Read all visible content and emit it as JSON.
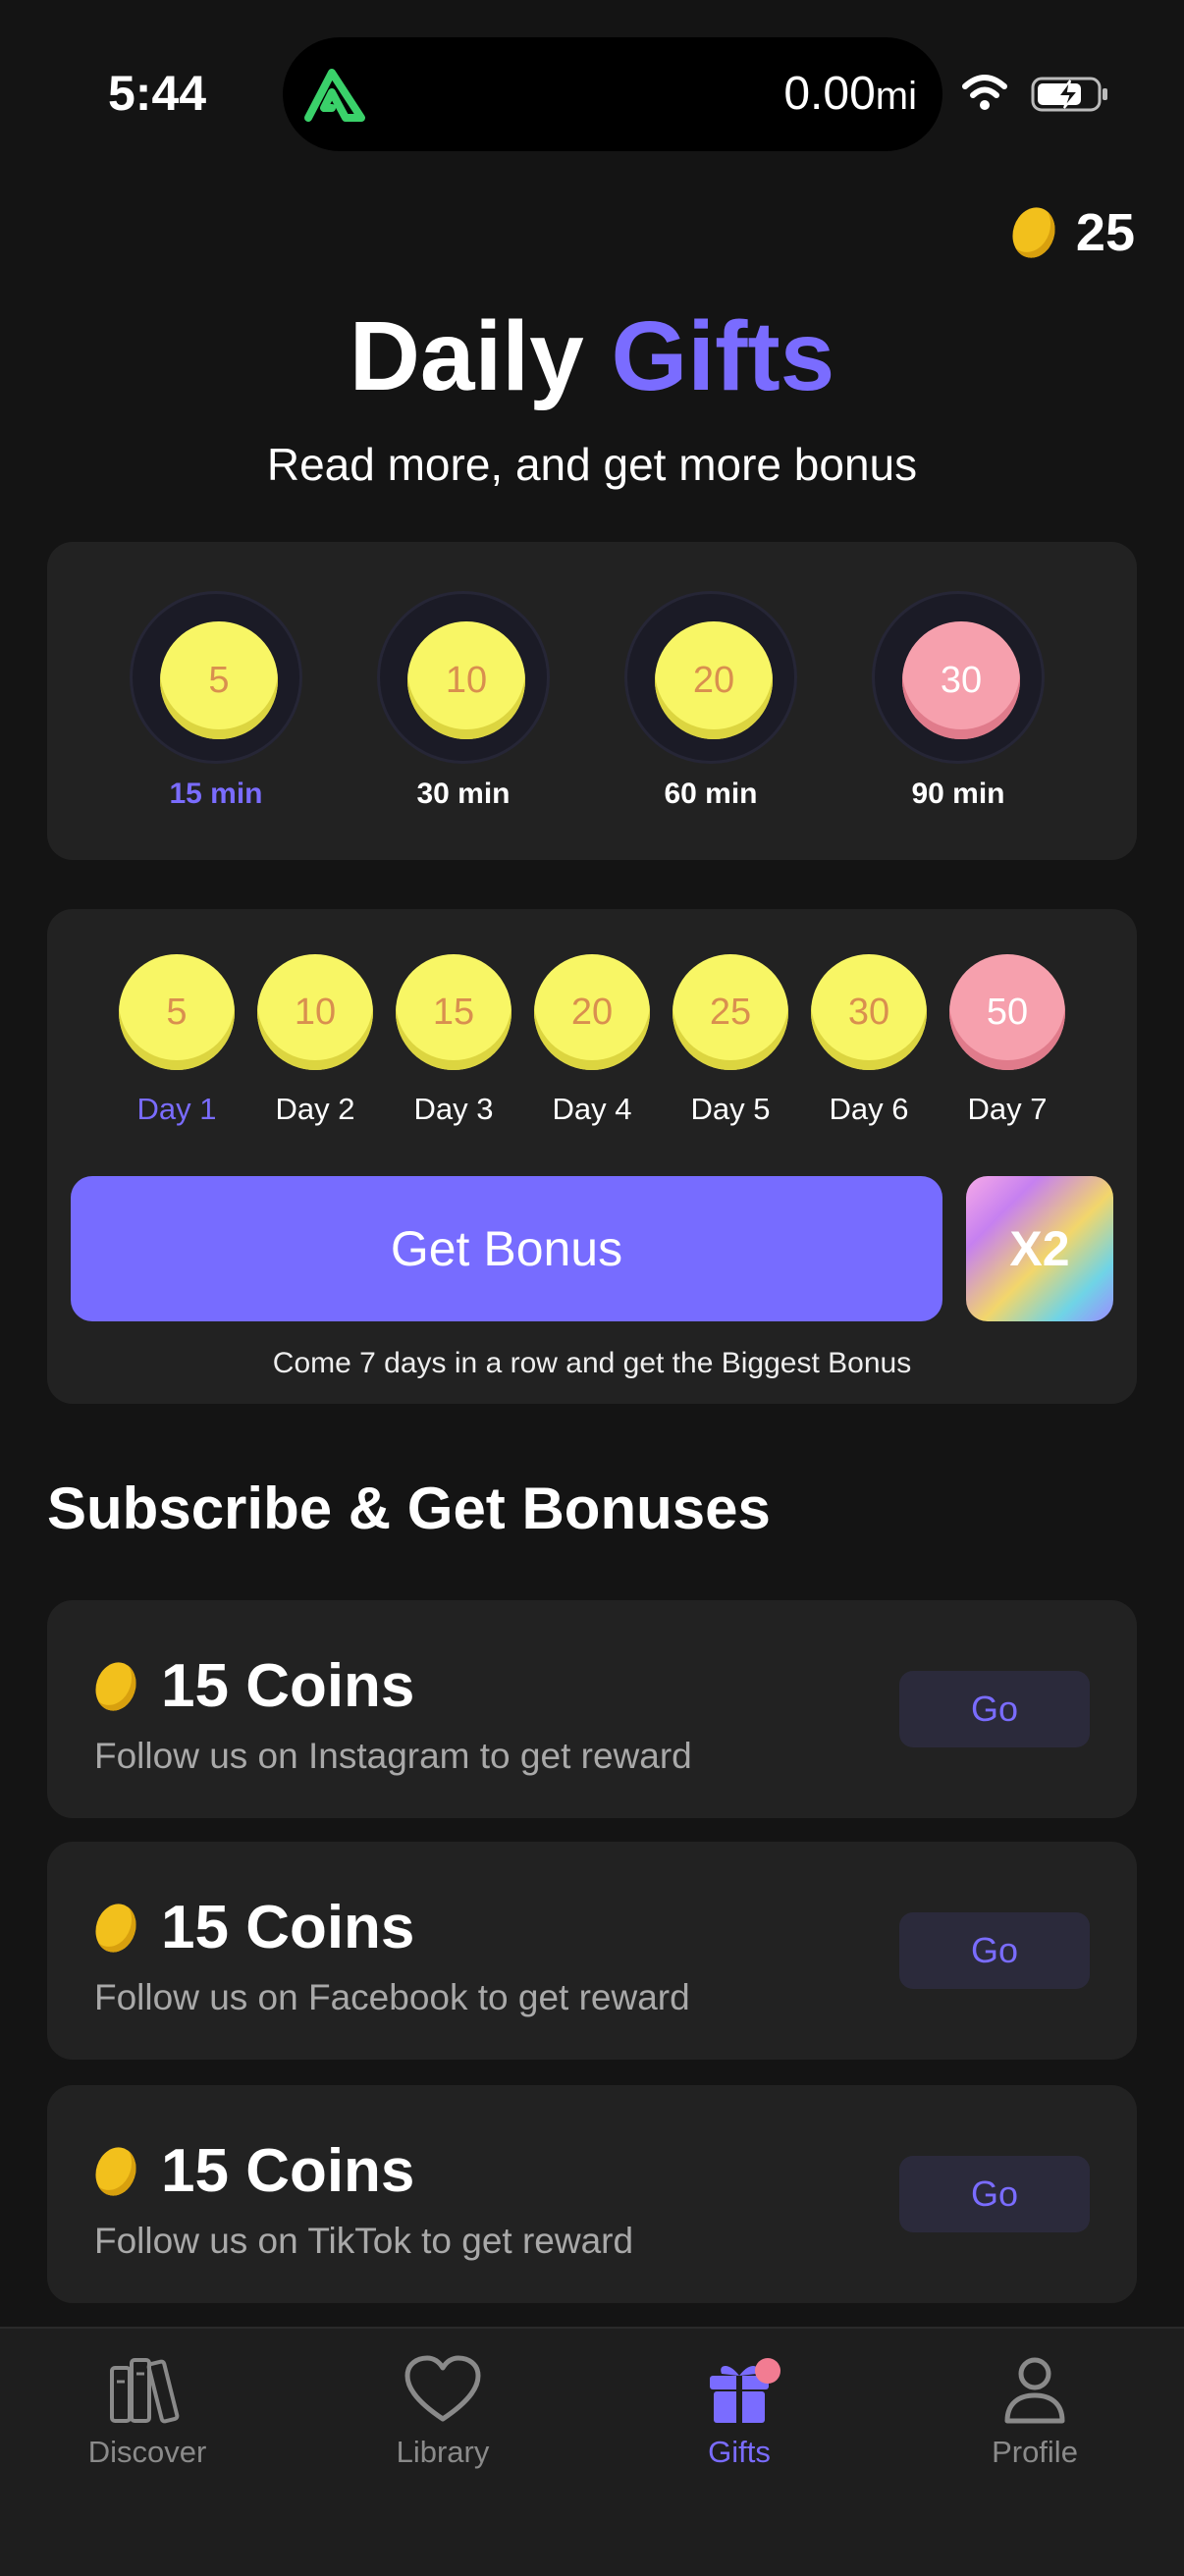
{
  "status": {
    "time": "5:44",
    "distance_value": "0.00",
    "distance_unit": "mi"
  },
  "balance": "25",
  "title": {
    "part1": "Daily",
    "part2": "Gifts"
  },
  "subtitle": "Read more, and get more bonus",
  "timers": [
    {
      "value": "5",
      "label": "15 min",
      "active": true
    },
    {
      "value": "10",
      "label": "30 min"
    },
    {
      "value": "20",
      "label": "60 min"
    },
    {
      "value": "30",
      "label": "90 min",
      "special": true
    }
  ],
  "days": [
    {
      "value": "5",
      "label": "Day 1",
      "active": true
    },
    {
      "value": "10",
      "label": "Day 2"
    },
    {
      "value": "15",
      "label": "Day 3"
    },
    {
      "value": "20",
      "label": "Day 4"
    },
    {
      "value": "25",
      "label": "Day 5"
    },
    {
      "value": "30",
      "label": "Day 6"
    },
    {
      "value": "50",
      "label": "Day 7",
      "special": true
    }
  ],
  "bonus_button": "Get Bonus",
  "multiplier": "X2",
  "streak_note": "Come 7 days in a row and get the Biggest Bonus",
  "section_title": "Subscribe & Get Bonuses",
  "subscriptions": [
    {
      "coins": "15 Coins",
      "desc": "Follow us on Instagram to get reward",
      "action": "Go"
    },
    {
      "coins": "15 Coins",
      "desc": "Follow us on Facebook to get reward",
      "action": "Go"
    },
    {
      "coins": "15 Coins",
      "desc": "Follow us on TikTok to get reward",
      "action": "Go"
    }
  ],
  "tabs": [
    {
      "label": "Discover",
      "icon": "books-icon"
    },
    {
      "label": "Library",
      "icon": "heart-icon"
    },
    {
      "label": "Gifts",
      "icon": "gift-icon",
      "active": true
    },
    {
      "label": "Profile",
      "icon": "person-icon"
    }
  ],
  "colors": {
    "accent": "#7a6cff",
    "coin_yellow": "#f8f665",
    "coin_pink": "#f6a0ad",
    "background": "#141414",
    "card": "#222222"
  }
}
